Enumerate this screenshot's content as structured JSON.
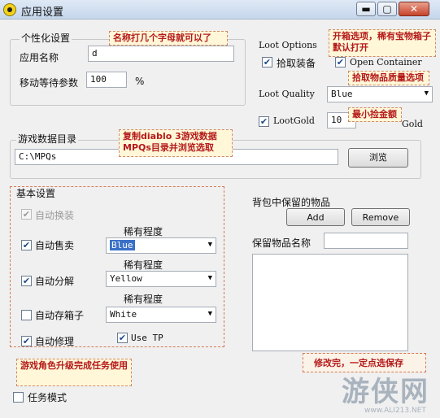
{
  "window": {
    "title": "应用设置",
    "minimize_glyph": "▬",
    "maximize_glyph": "▢",
    "close_glyph": "✕"
  },
  "personalize": {
    "title": "个性化设置",
    "app_name_label": "应用名称",
    "app_name_value": "d",
    "move_wait_label": "移动等待参数",
    "move_wait_value": "100",
    "move_wait_unit": "%",
    "callout": "名称打几个字母就可以了"
  },
  "loot": {
    "title": "Loot Options",
    "pickup_label": "拾取装备",
    "pickup_checked": true,
    "open_container_label": "Open Container",
    "open_container_checked": true,
    "quality_label": "Loot Quality",
    "quality_value": "Blue",
    "lootgold_label": "LootGold",
    "lootgold_checked": true,
    "lootgold_value": "10",
    "gold_label": "Gold",
    "callout_container": "开箱选项，稀有宝物箱子默认打开",
    "callout_quality": "拾取物品质量选项",
    "callout_gold": "最小捡金额"
  },
  "gamedir": {
    "title": "游戏数据目录",
    "path_value": "C:\\MPQs",
    "browse_label": "浏览",
    "callout": "复制diablo 3游戏数据MPQs目录并浏览选取"
  },
  "basic": {
    "title": "基本设置",
    "auto_equip": "自动换装",
    "rarity_label": "稀有程度",
    "auto_sell": "自动售卖",
    "sell_rarity": "Blue",
    "auto_salvage": "自动分解",
    "salvage_rarity": "Yellow",
    "auto_stash": "自动存箱子",
    "stash_rarity": "White",
    "auto_repair": "自动修理",
    "use_tp": "Use TP"
  },
  "keep": {
    "title": "背包中保留的物品",
    "add_label": "Add",
    "remove_label": "Remove",
    "name_label": "保留物品名称",
    "name_value": ""
  },
  "quest": {
    "label": "任务模式",
    "callout": "游戏角色升级完成任务使用"
  },
  "save_callout": "修改完，一定点选保存",
  "watermark": {
    "text": "游侠网",
    "url": "www.ALI213.NET"
  },
  "colors": {
    "callout_text": "#b51a1a",
    "callout_bg": "#fff7d8",
    "dash": "#d57a55"
  }
}
